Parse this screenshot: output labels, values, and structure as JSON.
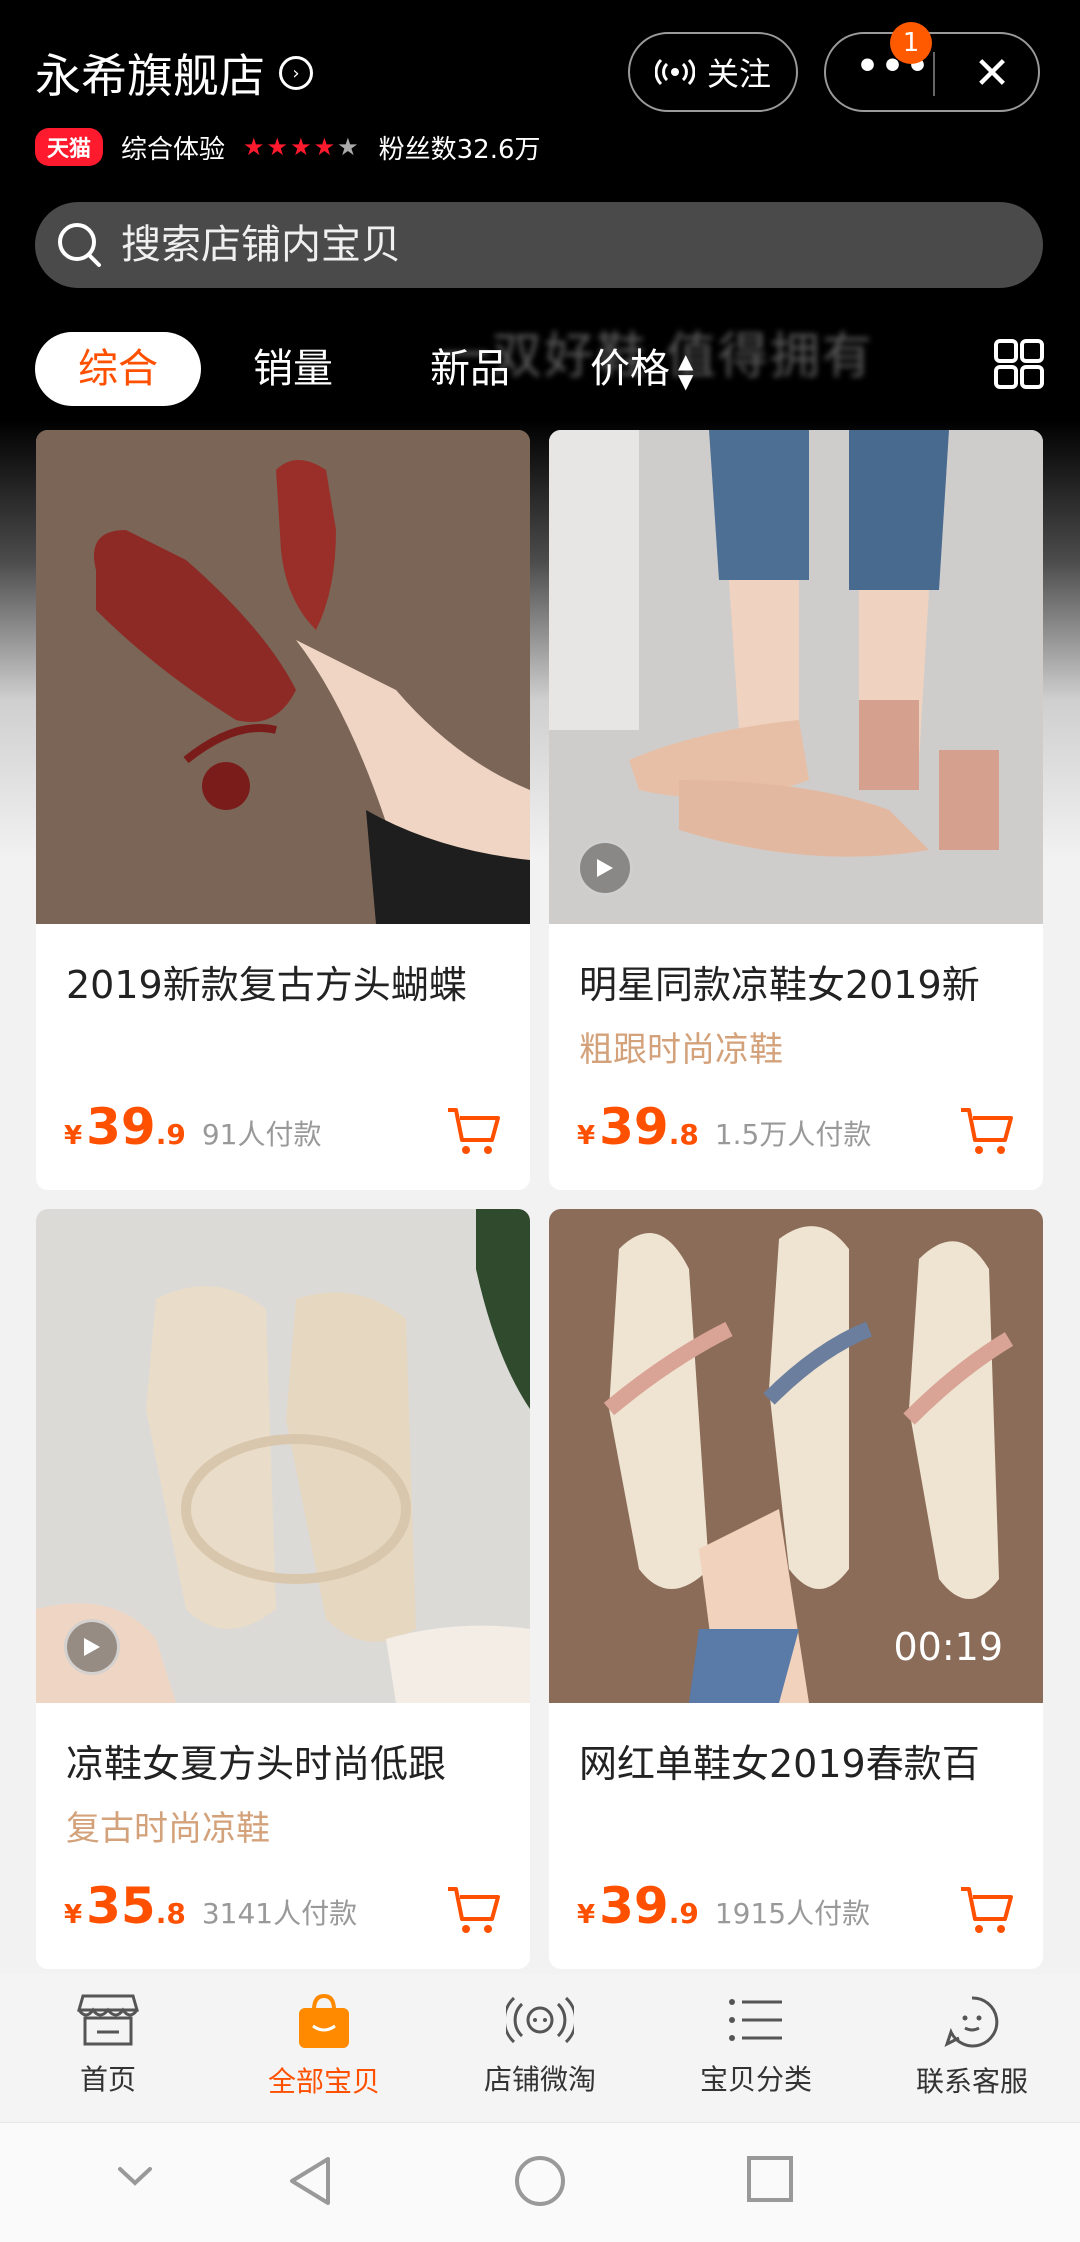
{
  "store": {
    "name": "永希旗舰店",
    "badge": "天猫",
    "rating_label": "综合体验",
    "rating_stars": 4,
    "fans": "粉丝数32.6万"
  },
  "header": {
    "follow_label": "关注",
    "notification_count": "1"
  },
  "search": {
    "placeholder": "搜索店铺内宝贝"
  },
  "banner": {
    "text": "一双好鞋 值得拥有"
  },
  "sort_tabs": [
    {
      "label": "综合",
      "active": true
    },
    {
      "label": "销量",
      "active": false
    },
    {
      "label": "新品",
      "active": false
    },
    {
      "label": "价格",
      "active": false
    }
  ],
  "products": [
    {
      "title": "2019新款复古方头蝴蝶",
      "subtitle": "",
      "price_int": "39",
      "price_dec": ".9",
      "paid": "91人付款",
      "video": false,
      "video_time": "",
      "image": "red-mule-heel"
    },
    {
      "title": "明星同款凉鞋女2019新",
      "subtitle": "粗跟时尚凉鞋",
      "price_int": "39",
      "price_dec": ".8",
      "paid": "1.5万人付款",
      "video": true,
      "video_time": "",
      "image": "pink-block-sandal"
    },
    {
      "title": "凉鞋女夏方头时尚低跟",
      "subtitle": "复古时尚凉鞋",
      "price_int": "35",
      "price_dec": ".8",
      "paid": "3141人付款",
      "video": true,
      "video_time": "",
      "image": "beige-square-sandal"
    },
    {
      "title": "网红单鞋女2019春款百",
      "subtitle": "",
      "price_int": "39",
      "price_dec": ".9",
      "paid": "1915人付款",
      "video": false,
      "video_time": "00:19",
      "image": "cream-pointed-flat"
    }
  ],
  "currency_symbol": "¥",
  "bottom_nav": [
    {
      "label": "首页",
      "icon": "storefront-icon",
      "active": false
    },
    {
      "label": "全部宝贝",
      "icon": "shopping-bag-icon",
      "active": true
    },
    {
      "label": "店铺微淘",
      "icon": "broadcast-icon",
      "active": false
    },
    {
      "label": "宝贝分类",
      "icon": "list-icon",
      "active": false
    },
    {
      "label": "联系客服",
      "icon": "chat-face-icon",
      "active": false
    }
  ],
  "colors": {
    "accent": "#ff5000",
    "tmall_red": "#ff1a2d",
    "subtitle": "#d4a27a"
  }
}
